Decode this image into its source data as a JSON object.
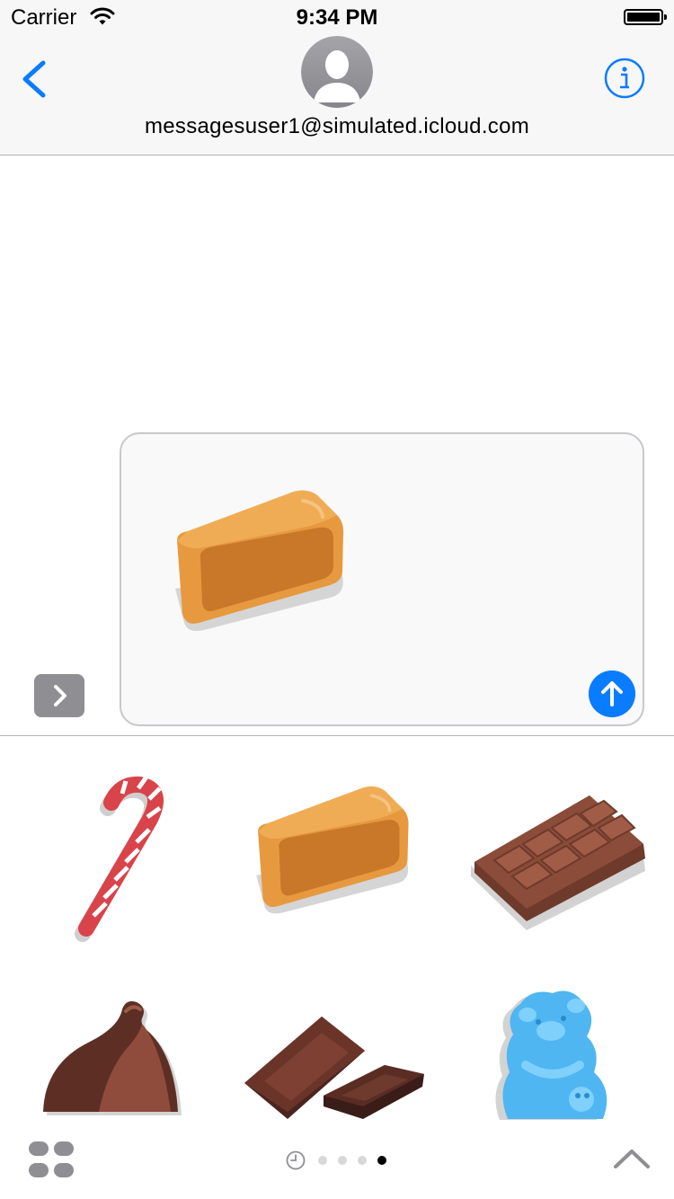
{
  "status_bar": {
    "carrier": "Carrier",
    "time": "9:34 PM"
  },
  "header": {
    "contact": "messagesuser1@simulated.icloud.com"
  },
  "compose": {
    "sticker": "caramel-sticker"
  },
  "drawer": {
    "stickers": [
      "candy-cane-sticker",
      "caramel-sticker",
      "chocolate-bar-sticker",
      "chocolate-chip-sticker",
      "chocolate-pieces-sticker",
      "gummy-bear-sticker"
    ]
  },
  "page_indicator": {
    "pages": 4,
    "active_index": 3
  },
  "colors": {
    "accent": "#0a7cff",
    "gray_button": "#8e8e93",
    "bar_bg": "#f7f7f7"
  }
}
